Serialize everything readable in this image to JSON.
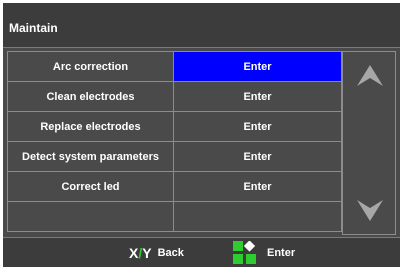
{
  "window": {
    "title": "Maintain"
  },
  "menu": {
    "rows": [
      {
        "label": "Arc correction",
        "value": "Enter",
        "selected": true
      },
      {
        "label": "Clean electrodes",
        "value": "Enter",
        "selected": false
      },
      {
        "label": "Replace electrodes",
        "value": "Enter",
        "selected": false
      },
      {
        "label": "Detect system parameters",
        "value": "Enter",
        "selected": false
      },
      {
        "label": "Correct led",
        "value": "Enter",
        "selected": false
      },
      {
        "label": "",
        "value": "",
        "selected": false
      }
    ]
  },
  "scroll": {
    "up_icon": "arrow-up-icon",
    "down_icon": "arrow-down-icon"
  },
  "footer": {
    "back": {
      "icon_x": "X",
      "icon_slash": "/",
      "icon_y": "Y",
      "label": "Back"
    },
    "enter": {
      "icon": "green-grid-icon",
      "label": "Enter"
    }
  },
  "colors": {
    "background": "#4a4a4a",
    "title_bar": "#3c3c3c",
    "grid_line": "#8c8c8c",
    "selected": "#0000ff",
    "accent_green": "#2ecc2e",
    "arrow": "#a7a7a7"
  }
}
